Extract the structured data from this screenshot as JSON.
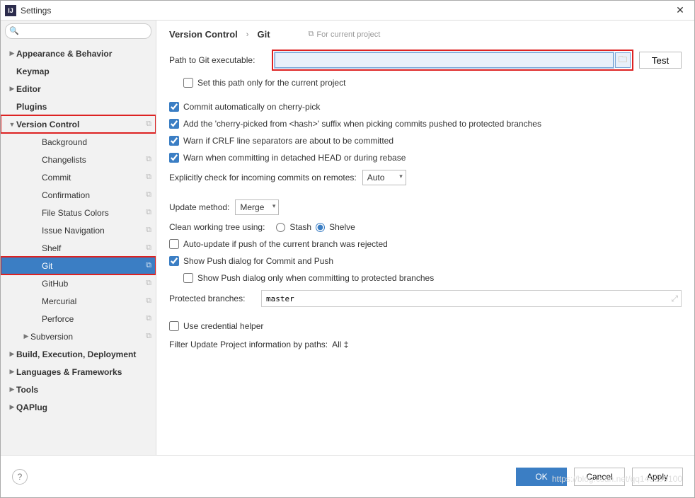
{
  "window": {
    "title": "Settings"
  },
  "search": {
    "placeholder": ""
  },
  "sidebar": {
    "items": [
      {
        "label": "Appearance & Behavior",
        "level": 0,
        "bold": true,
        "arrow": "▶",
        "copy": false
      },
      {
        "label": "Keymap",
        "level": 0,
        "bold": true,
        "arrow": "",
        "copy": false
      },
      {
        "label": "Editor",
        "level": 0,
        "bold": true,
        "arrow": "▶",
        "copy": false
      },
      {
        "label": "Plugins",
        "level": 0,
        "bold": true,
        "arrow": "",
        "copy": false
      },
      {
        "label": "Version Control",
        "level": 0,
        "bold": true,
        "arrow": "▼",
        "copy": true,
        "highlight": true
      },
      {
        "label": "Background",
        "level": 2,
        "copy": false
      },
      {
        "label": "Changelists",
        "level": 2,
        "copy": true
      },
      {
        "label": "Commit",
        "level": 2,
        "copy": true
      },
      {
        "label": "Confirmation",
        "level": 2,
        "copy": true
      },
      {
        "label": "File Status Colors",
        "level": 2,
        "copy": true
      },
      {
        "label": "Issue Navigation",
        "level": 2,
        "copy": true
      },
      {
        "label": "Shelf",
        "level": 2,
        "copy": true
      },
      {
        "label": "Git",
        "level": 2,
        "copy": true,
        "selected": true,
        "highlight": true
      },
      {
        "label": "GitHub",
        "level": 2,
        "copy": true
      },
      {
        "label": "Mercurial",
        "level": 2,
        "copy": true
      },
      {
        "label": "Perforce",
        "level": 2,
        "copy": true
      },
      {
        "label": "Subversion",
        "level": 1,
        "arrow": "▶",
        "copy": true
      },
      {
        "label": "Build, Execution, Deployment",
        "level": 0,
        "bold": true,
        "arrow": "▶",
        "copy": false
      },
      {
        "label": "Languages & Frameworks",
        "level": 0,
        "bold": true,
        "arrow": "▶",
        "copy": false
      },
      {
        "label": "Tools",
        "level": 0,
        "bold": true,
        "arrow": "▶",
        "copy": false
      },
      {
        "label": "QAPlug",
        "level": 0,
        "bold": true,
        "arrow": "▶",
        "copy": false
      }
    ]
  },
  "breadcrumb": {
    "parent": "Version Control",
    "sep": "›",
    "current": "Git",
    "scope": "For current project"
  },
  "main": {
    "path_label": "Path to Git executable:",
    "path_value": "",
    "test_label": "Test",
    "set_path_only": "Set this path only for the current project",
    "commit_auto": "Commit automatically on cherry-pick",
    "add_suffix": "Add the 'cherry-picked from <hash>' suffix when picking commits pushed to protected branches",
    "warn_crlf": "Warn if CRLF line separators are about to be committed",
    "warn_detached": "Warn when committing in detached HEAD or during rebase",
    "explicit_check": "Explicitly check for incoming commits on remotes:",
    "explicit_value": "Auto",
    "update_method_label": "Update method:",
    "update_method_value": "Merge",
    "clean_tree_label": "Clean working tree using:",
    "stash": "Stash",
    "shelve": "Shelve",
    "auto_update": "Auto-update if push of the current branch was rejected",
    "show_push": "Show Push dialog for Commit and Push",
    "show_push_protected": "Show Push dialog only when committing to protected branches",
    "protected_label": "Protected branches:",
    "protected_value": "master",
    "use_cred": "Use credential helper",
    "filter_label": "Filter Update Project information by paths:",
    "filter_value": "All ‡"
  },
  "footer": {
    "ok": "OK",
    "cancel": "Cancel",
    "apply": "Apply"
  },
  "watermark": "https://blog.csdn.net/qq140599100"
}
